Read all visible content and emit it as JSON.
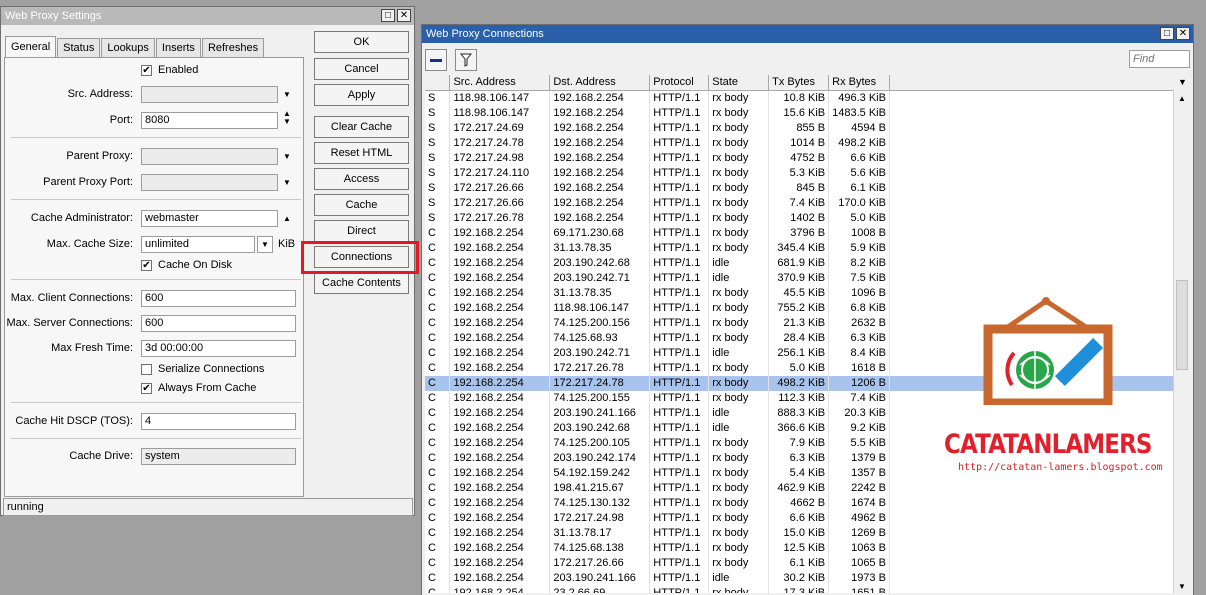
{
  "settings_window": {
    "title": "Web Proxy Settings",
    "tabs": [
      "General",
      "Status",
      "Lookups",
      "Inserts",
      "Refreshes"
    ],
    "enabled_label": "Enabled",
    "src_address_label": "Src. Address:",
    "port_label": "Port:",
    "port_value": "8080",
    "parent_proxy_label": "Parent Proxy:",
    "parent_proxy_port_label": "Parent Proxy Port:",
    "cache_admin_label": "Cache Administrator:",
    "cache_admin_value": "webmaster",
    "max_cache_size_label": "Max. Cache Size:",
    "max_cache_size_value": "unlimited",
    "max_cache_size_unit": "KiB",
    "cache_on_disk_label": "Cache On Disk",
    "max_client_conn_label": "Max. Client Connections:",
    "max_client_conn_value": "600",
    "max_server_conn_label": "Max. Server Connections:",
    "max_server_conn_value": "600",
    "max_fresh_time_label": "Max Fresh Time:",
    "max_fresh_time_value": "3d 00:00:00",
    "serialize_label": "Serialize Connections",
    "always_from_cache_label": "Always From Cache",
    "cache_hit_dscp_label": "Cache Hit DSCP (TOS):",
    "cache_hit_dscp_value": "4",
    "cache_drive_label": "Cache Drive:",
    "cache_drive_value": "system",
    "buttons": [
      "OK",
      "Cancel",
      "Apply",
      "Clear Cache",
      "Reset HTML",
      "Access",
      "Cache",
      "Direct",
      "Connections",
      "Cache Contents"
    ],
    "status": "running",
    "highlight_color": "#e01b22"
  },
  "connections_window": {
    "title": "Web Proxy Connections",
    "find_placeholder": "Find",
    "columns": [
      "Src. Address",
      "Dst. Address",
      "Protocol",
      "State",
      "Tx Bytes",
      "Rx Bytes"
    ],
    "selected_row": 19,
    "rows": [
      [
        "S",
        "118.98.106.147",
        "192.168.2.254",
        "HTTP/1.1",
        "rx body",
        "10.8 KiB",
        "496.3 KiB"
      ],
      [
        "S",
        "118.98.106.147",
        "192.168.2.254",
        "HTTP/1.1",
        "rx body",
        "15.6 KiB",
        "1483.5 KiB"
      ],
      [
        "S",
        "172.217.24.69",
        "192.168.2.254",
        "HTTP/1.1",
        "rx body",
        "855 B",
        "4594 B"
      ],
      [
        "S",
        "172.217.24.78",
        "192.168.2.254",
        "HTTP/1.1",
        "rx body",
        "1014 B",
        "498.2 KiB"
      ],
      [
        "S",
        "172.217.24.98",
        "192.168.2.254",
        "HTTP/1.1",
        "rx body",
        "4752 B",
        "6.6 KiB"
      ],
      [
        "S",
        "172.217.24.110",
        "192.168.2.254",
        "HTTP/1.1",
        "rx body",
        "5.3 KiB",
        "5.6 KiB"
      ],
      [
        "S",
        "172.217.26.66",
        "192.168.2.254",
        "HTTP/1.1",
        "rx body",
        "845 B",
        "6.1 KiB"
      ],
      [
        "S",
        "172.217.26.66",
        "192.168.2.254",
        "HTTP/1.1",
        "rx body",
        "7.4 KiB",
        "170.0 KiB"
      ],
      [
        "S",
        "172.217.26.78",
        "192.168.2.254",
        "HTTP/1.1",
        "rx body",
        "1402 B",
        "5.0 KiB"
      ],
      [
        "C",
        "192.168.2.254",
        "69.171.230.68",
        "HTTP/1.1",
        "rx body",
        "3796 B",
        "1008 B"
      ],
      [
        "C",
        "192.168.2.254",
        "31.13.78.35",
        "HTTP/1.1",
        "rx body",
        "345.4 KiB",
        "5.9 KiB"
      ],
      [
        "C",
        "192.168.2.254",
        "203.190.242.68",
        "HTTP/1.1",
        "idle",
        "681.9 KiB",
        "8.2 KiB"
      ],
      [
        "C",
        "192.168.2.254",
        "203.190.242.71",
        "HTTP/1.1",
        "idle",
        "370.9 KiB",
        "7.5 KiB"
      ],
      [
        "C",
        "192.168.2.254",
        "31.13.78.35",
        "HTTP/1.1",
        "rx body",
        "45.5 KiB",
        "1096 B"
      ],
      [
        "C",
        "192.168.2.254",
        "118.98.106.147",
        "HTTP/1.1",
        "rx body",
        "755.2 KiB",
        "6.8 KiB"
      ],
      [
        "C",
        "192.168.2.254",
        "74.125.200.156",
        "HTTP/1.1",
        "rx body",
        "21.3 KiB",
        "2632 B"
      ],
      [
        "C",
        "192.168.2.254",
        "74.125.68.93",
        "HTTP/1.1",
        "rx body",
        "28.4 KiB",
        "6.3 KiB"
      ],
      [
        "C",
        "192.168.2.254",
        "203.190.242.71",
        "HTTP/1.1",
        "idle",
        "256.1 KiB",
        "8.4 KiB"
      ],
      [
        "C",
        "192.168.2.254",
        "172.217.26.78",
        "HTTP/1.1",
        "rx body",
        "5.0 KiB",
        "1618 B"
      ],
      [
        "C",
        "192.168.2.254",
        "172.217.24.78",
        "HTTP/1.1",
        "rx body",
        "498.2 KiB",
        "1206 B"
      ],
      [
        "C",
        "192.168.2.254",
        "74.125.200.155",
        "HTTP/1.1",
        "rx body",
        "112.3 KiB",
        "7.4 KiB"
      ],
      [
        "C",
        "192.168.2.254",
        "203.190.241.166",
        "HTTP/1.1",
        "idle",
        "888.3 KiB",
        "20.3 KiB"
      ],
      [
        "C",
        "192.168.2.254",
        "203.190.242.68",
        "HTTP/1.1",
        "idle",
        "366.6 KiB",
        "9.2 KiB"
      ],
      [
        "C",
        "192.168.2.254",
        "74.125.200.105",
        "HTTP/1.1",
        "rx body",
        "7.9 KiB",
        "5.5 KiB"
      ],
      [
        "C",
        "192.168.2.254",
        "203.190.242.174",
        "HTTP/1.1",
        "rx body",
        "6.3 KiB",
        "1379 B"
      ],
      [
        "C",
        "192.168.2.254",
        "54.192.159.242",
        "HTTP/1.1",
        "rx body",
        "5.4 KiB",
        "1357 B"
      ],
      [
        "C",
        "192.168.2.254",
        "198.41.215.67",
        "HTTP/1.1",
        "rx body",
        "462.9 KiB",
        "2242 B"
      ],
      [
        "C",
        "192.168.2.254",
        "74.125.130.132",
        "HTTP/1.1",
        "rx body",
        "4662 B",
        "1674 B"
      ],
      [
        "C",
        "192.168.2.254",
        "172.217.24.98",
        "HTTP/1.1",
        "rx body",
        "6.6 KiB",
        "4962 B"
      ],
      [
        "C",
        "192.168.2.254",
        "31.13.78.17",
        "HTTP/1.1",
        "rx body",
        "15.0 KiB",
        "1269 B"
      ],
      [
        "C",
        "192.168.2.254",
        "74.125.68.138",
        "HTTP/1.1",
        "rx body",
        "12.5 KiB",
        "1063 B"
      ],
      [
        "C",
        "192.168.2.254",
        "172.217.26.66",
        "HTTP/1.1",
        "rx body",
        "6.1 KiB",
        "1065 B"
      ],
      [
        "C",
        "192.168.2.254",
        "203.190.241.166",
        "HTTP/1.1",
        "idle",
        "30.2 KiB",
        "1973 B"
      ],
      [
        "C",
        "192.168.2.254",
        "23.2.66.69",
        "HTTP/1.1",
        "rx body",
        "17.3 KiB",
        "1651 B"
      ]
    ]
  },
  "watermark": {
    "brand": "CATATANLAMERS",
    "url": "http://catatan-lamers.blogspot.com"
  }
}
